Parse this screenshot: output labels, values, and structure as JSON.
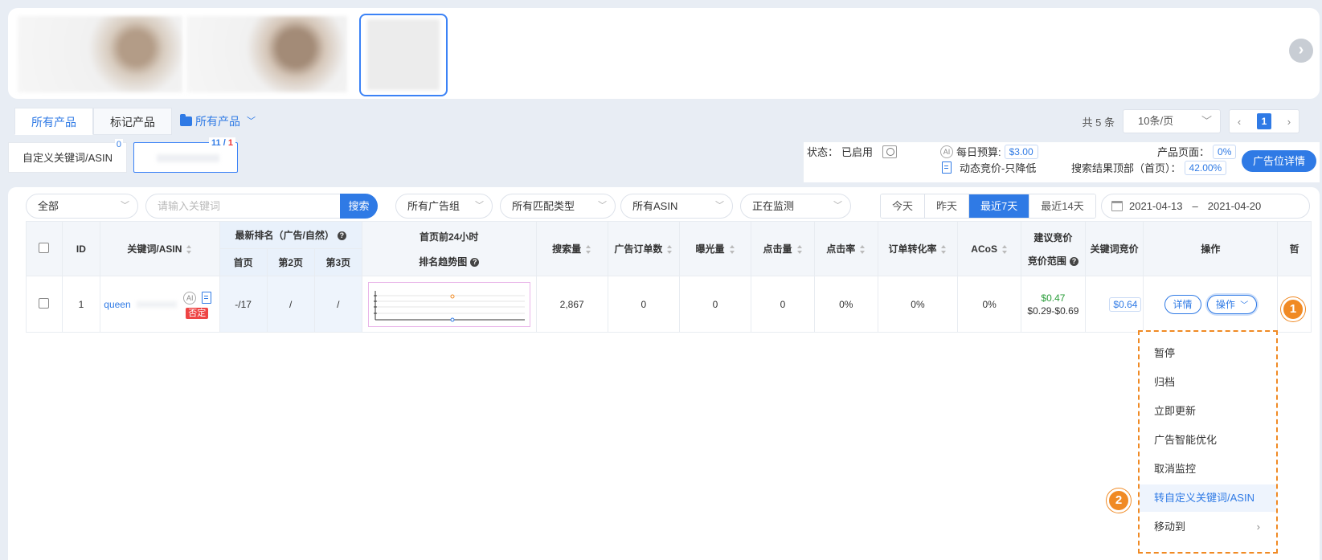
{
  "tabs": {
    "all_products": "所有产品",
    "marked_products": "标记产品",
    "folder_label": "所有产品"
  },
  "pager": {
    "total": "共 5 条",
    "page_size": "10条/页",
    "current_page": "1"
  },
  "kw_tabs": {
    "custom_label": "自定义关键词/ASIN",
    "custom_count": "0",
    "tracked_count_a": "11",
    "tracked_sep": "/",
    "tracked_count_b": "1"
  },
  "status": {
    "state_label": "状态：",
    "state_value": "已启用",
    "budget_label": "每日预算:",
    "budget_value": "$3.00",
    "bid_strategy": "动态竞价-只降低",
    "product_page_label": "产品页面：",
    "product_page_value": "0%",
    "top_search_label": "搜索结果顶部（首页）：",
    "top_search_value": "42.00%",
    "ad_detail_button": "广告位详情"
  },
  "filters": {
    "all": "全部",
    "search_placeholder": "请输入关键词",
    "search_button": "搜索",
    "ad_group": "所有广告组",
    "match_type": "所有匹配类型",
    "asin": "所有ASIN",
    "monitoring": "正在监测",
    "date_ranges": [
      "今天",
      "昨天",
      "最近7天",
      "最近14天"
    ],
    "date_start": "2021-04-13",
    "date_sep": "–",
    "date_end": "2021-04-20"
  },
  "table": {
    "headers": {
      "id": "ID",
      "keyword": "关键词/ASIN",
      "rank_group": "最新排名（广告/自然）",
      "rank_p1": "首页",
      "rank_p2": "第2页",
      "rank_p3": "第3页",
      "trend_1": "首页前24小时",
      "trend_2": "排名趋势图",
      "search_volume": "搜索量",
      "ad_orders": "广告订单数",
      "impressions": "曝光量",
      "clicks": "点击量",
      "ctr": "点击率",
      "cvr": "订单转化率",
      "acos": "ACoS",
      "suggested_1": "建议竞价",
      "suggested_2": "竞价范围",
      "kw_bid": "关键词竞价",
      "actions": "操作",
      "extra": "哲"
    },
    "row": {
      "id": "1",
      "keyword": "queen",
      "ai": "AI",
      "negative": "否定",
      "rank_p1": "-/17",
      "rank_p2": "/",
      "rank_p3": "/",
      "search_volume": "2,867",
      "ad_orders": "0",
      "impressions": "0",
      "clicks": "0",
      "ctr": "0%",
      "cvr": "0%",
      "acos": "0%",
      "suggested_bid": "$0.47",
      "bid_range": "$0.29-$0.69",
      "kw_bid": "$0.64",
      "detail_button": "详情",
      "action_button": "操作"
    }
  },
  "menu": {
    "items": [
      "暂停",
      "归档",
      "立即更新",
      "广告智能优化",
      "取消监控",
      "转自定义关键词/ASIN",
      "移动到"
    ],
    "highlighted_index": 5
  },
  "markers": [
    "1",
    "2"
  ],
  "colors": {
    "primary": "#2f7ae5",
    "highlight_orange": "#f08a24",
    "negative_red": "#e44",
    "bid_green": "#2a9d3a"
  }
}
